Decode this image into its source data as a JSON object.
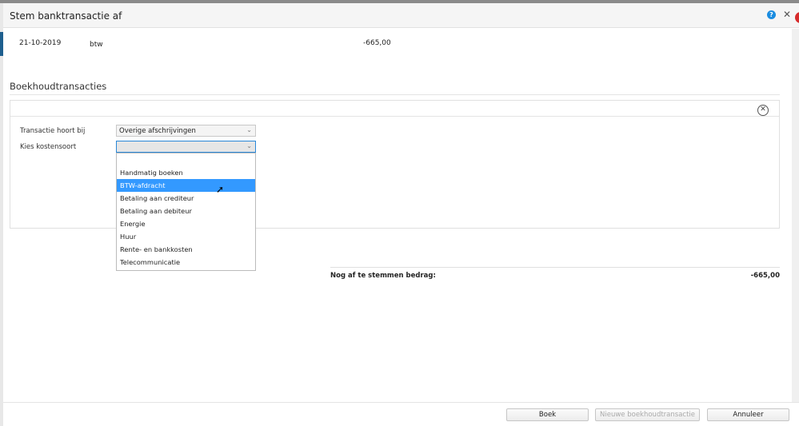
{
  "dialog": {
    "title": "Stem banktransactie af",
    "help_icon": "question-circle-icon",
    "close_icon": "close-icon"
  },
  "transaction": {
    "date": "21-10-2019",
    "description": "btw",
    "amount": "-665,00"
  },
  "section": {
    "title": "Boekhoudtransacties"
  },
  "form": {
    "belongs_label": "Transactie hoort bij",
    "belongs_value": "Overige afschrijvingen",
    "cost_label": "Kies kostensoort",
    "cost_value": "",
    "options": [
      "",
      "Handmatig boeken",
      "BTW-afdracht",
      "Betaling aan crediteur",
      "Betaling aan debiteur",
      "Energie",
      "Huur",
      "Rente- en bankkosten",
      "Telecommunicatie"
    ],
    "highlighted": "BTW-afdracht"
  },
  "summary": {
    "label": "Nog af te stemmen bedrag:",
    "value": "-665,00"
  },
  "footer": {
    "book": "Boek",
    "new": "Nieuwe boekhoudtransactie",
    "cancel": "Annuleer"
  },
  "colors": {
    "accent": "#3399ff",
    "help": "#1a8ce0"
  }
}
